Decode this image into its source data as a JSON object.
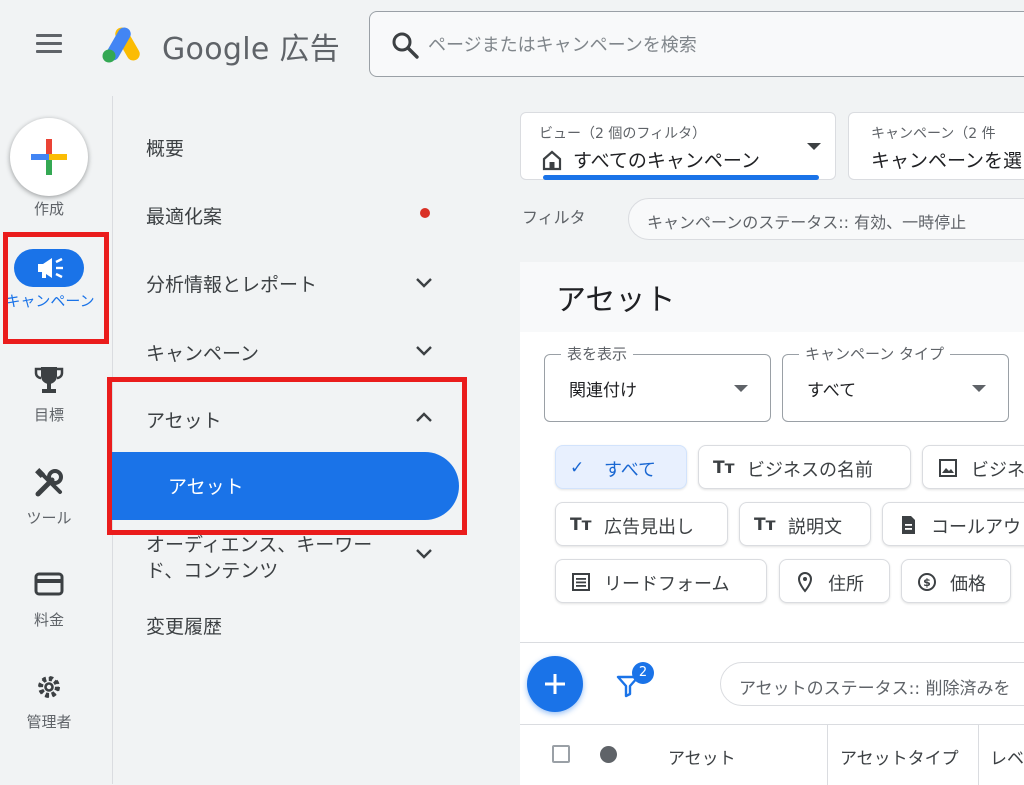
{
  "header": {
    "brand": "Google 広告",
    "search_placeholder": "ページまたはキャンペーンを検索"
  },
  "rail": {
    "create_label": "作成",
    "campaign_label": "キャンペーン",
    "goals_label": "目標",
    "tools_label": "ツール",
    "billing_label": "料金",
    "admin_label": "管理者"
  },
  "nav": {
    "overview": "概要",
    "recommendations": "最適化案",
    "insights": "分析情報とレポート",
    "campaigns": "キャンペーン",
    "assets": "アセット",
    "assets_sub": "アセット",
    "audiences": "オーディエンス、キーワード、コンテンツ",
    "change_history": "変更履歴"
  },
  "views": {
    "view_label": "ビュー（2 個のフィルタ）",
    "view_value": "すべてのキャンペーン",
    "campaign_label": "キャンペーン（2 件",
    "campaign_value": "キャンペーンを選"
  },
  "filters": {
    "label": "フィルタ",
    "chip": "キャンペーンのステータス:: 有効、一時停止"
  },
  "page": {
    "title": "アセット"
  },
  "dropdowns": [
    {
      "label": "表を表示",
      "value": "関連付け"
    },
    {
      "label": "キャンペーン タイプ",
      "value": "すべて"
    }
  ],
  "chips": [
    {
      "label": "すべて",
      "icon": "check-icon"
    },
    {
      "label": "ビジネスの名前",
      "icon": "text-icon"
    },
    {
      "label": "ビジネ",
      "icon": "image-icon"
    },
    {
      "label": "広告見出し",
      "icon": "text-icon"
    },
    {
      "label": "説明文",
      "icon": "text-icon"
    },
    {
      "label": "コールアウ",
      "icon": "document-icon"
    },
    {
      "label": "リードフォーム",
      "icon": "form-icon"
    },
    {
      "label": "住所",
      "icon": "location-icon"
    },
    {
      "label": "価格",
      "icon": "price-icon"
    }
  ],
  "toolbar": {
    "filter_count": "2",
    "status_chip": "アセットのステータス:: 削除済みを"
  },
  "table": {
    "headers": [
      "アセット",
      "アセットタイプ",
      "レベ"
    ]
  },
  "colors": {
    "accent": "#1a73e8",
    "highlight_border": "#ea1c1c",
    "notification_dot": "#d93025"
  }
}
